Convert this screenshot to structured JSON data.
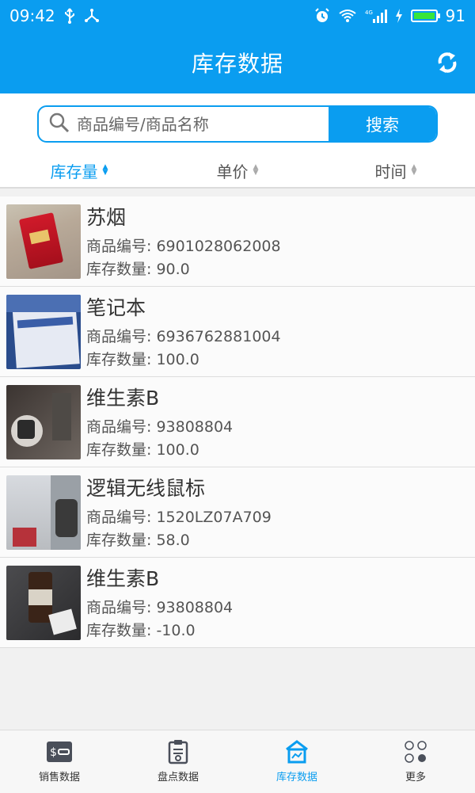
{
  "status_bar": {
    "time": "09:42",
    "battery": "91"
  },
  "header": {
    "title": "库存数据"
  },
  "search": {
    "placeholder": "商品编号/商品名称",
    "button_label": "搜索"
  },
  "sort": [
    {
      "label": "库存量",
      "active": true
    },
    {
      "label": "单价",
      "active": false
    },
    {
      "label": "时间",
      "active": false
    }
  ],
  "list": [
    {
      "name": "苏烟",
      "code_label": "商品编号: 6901028062008",
      "qty_label": "库存数量: 90.0"
    },
    {
      "name": "笔记本",
      "code_label": "商品编号: 6936762881004",
      "qty_label": "库存数量: 100.0"
    },
    {
      "name": "维生素B",
      "code_label": "商品编号: 93808804",
      "qty_label": "库存数量: 100.0"
    },
    {
      "name": "逻辑无线鼠标",
      "code_label": "商品编号: 1520LZ07A709",
      "qty_label": "库存数量: 58.0"
    },
    {
      "name": "维生素B",
      "code_label": "商品编号: 93808804",
      "qty_label": "库存数量: -10.0"
    }
  ],
  "nav": [
    {
      "label": "销售数据",
      "icon": "sales-icon"
    },
    {
      "label": "盘点数据",
      "icon": "clipboard-icon"
    },
    {
      "label": "库存数据",
      "icon": "warehouse-icon",
      "active": true
    },
    {
      "label": "更多",
      "icon": "more-icon"
    }
  ],
  "colors": {
    "accent": "#0a9df0",
    "battery": "#38e63a"
  }
}
